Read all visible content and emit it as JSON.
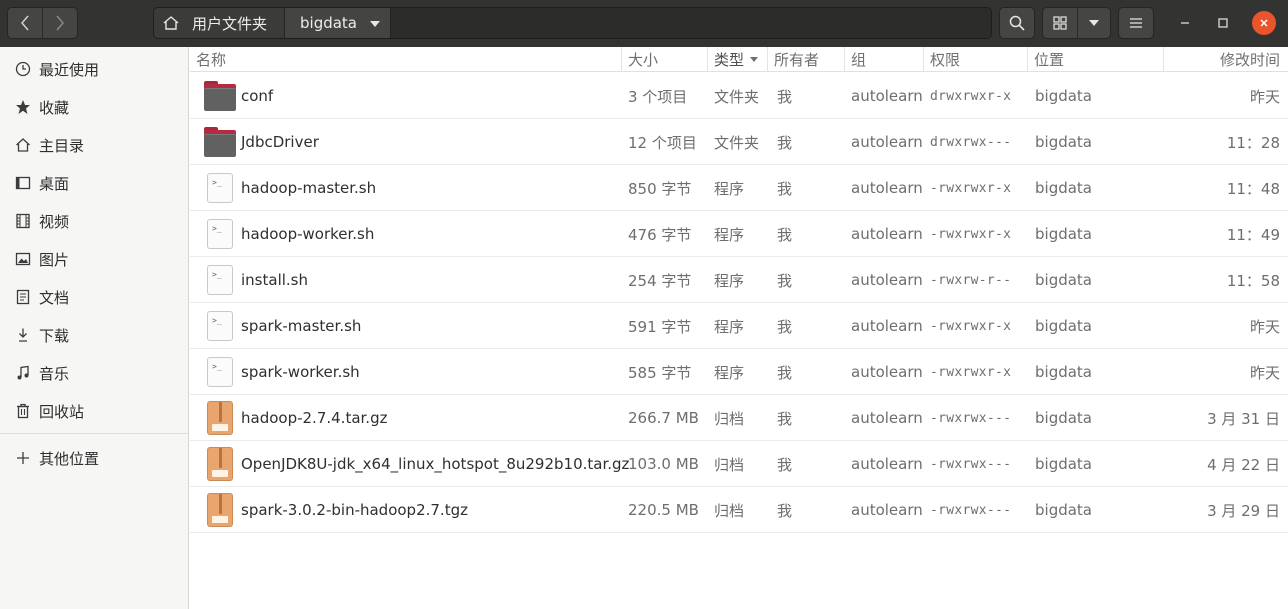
{
  "header": {
    "breadcrumbs": [
      "用户文件夹",
      "bigdata"
    ]
  },
  "sidebar": {
    "items": [
      {
        "label": "最近使用",
        "icon": "clock-icon"
      },
      {
        "label": "收藏",
        "icon": "star-icon"
      },
      {
        "label": "主目录",
        "icon": "home-icon"
      },
      {
        "label": "桌面",
        "icon": "desktop-icon"
      },
      {
        "label": "视频",
        "icon": "film-icon"
      },
      {
        "label": "图片",
        "icon": "image-icon"
      },
      {
        "label": "文档",
        "icon": "document-icon"
      },
      {
        "label": "下载",
        "icon": "download-icon"
      },
      {
        "label": "音乐",
        "icon": "music-icon"
      },
      {
        "label": "回收站",
        "icon": "trash-icon"
      }
    ],
    "other": {
      "label": "其他位置",
      "icon": "plus-icon"
    }
  },
  "columns": {
    "name": "名称",
    "size": "大小",
    "type": "类型",
    "owner": "所有者",
    "group": "组",
    "perm": "权限",
    "location": "位置",
    "modified": "修改时间"
  },
  "files": [
    {
      "icon": "folder",
      "name": "conf",
      "size": "3 个项目",
      "type": "文件夹",
      "owner": "我",
      "group": "autolearn",
      "perm": "drwxrwxr-x",
      "location": "bigdata",
      "modified": "昨天"
    },
    {
      "icon": "folder",
      "name": "JdbcDriver",
      "size": "12 个项目",
      "type": "文件夹",
      "owner": "我",
      "group": "autolearn",
      "perm": "drwxrwx---",
      "location": "bigdata",
      "modified": "11：28"
    },
    {
      "icon": "script",
      "name": "hadoop-master.sh",
      "size": "850 字节",
      "type": "程序",
      "owner": "我",
      "group": "autolearn",
      "perm": "-rwxrwxr-x",
      "location": "bigdata",
      "modified": "11：48"
    },
    {
      "icon": "script",
      "name": "hadoop-worker.sh",
      "size": "476 字节",
      "type": "程序",
      "owner": "我",
      "group": "autolearn",
      "perm": "-rwxrwxr-x",
      "location": "bigdata",
      "modified": "11：49"
    },
    {
      "icon": "script",
      "name": "install.sh",
      "size": "254 字节",
      "type": "程序",
      "owner": "我",
      "group": "autolearn",
      "perm": "-rwxrw-r--",
      "location": "bigdata",
      "modified": "11：58"
    },
    {
      "icon": "script",
      "name": "spark-master.sh",
      "size": "591 字节",
      "type": "程序",
      "owner": "我",
      "group": "autolearn",
      "perm": "-rwxrwxr-x",
      "location": "bigdata",
      "modified": "昨天"
    },
    {
      "icon": "script",
      "name": "spark-worker.sh",
      "size": "585 字节",
      "type": "程序",
      "owner": "我",
      "group": "autolearn",
      "perm": "-rwxrwxr-x",
      "location": "bigdata",
      "modified": "昨天"
    },
    {
      "icon": "archive",
      "name": "hadoop-2.7.4.tar.gz",
      "size": "266.7 MB",
      "type": "归档",
      "owner": "我",
      "group": "autolearn",
      "perm": "-rwxrwx---",
      "location": "bigdata",
      "modified": "3 月 31 日"
    },
    {
      "icon": "archive",
      "name": "OpenJDK8U-jdk_x64_linux_hotspot_8u292b10.tar.gz",
      "size": "103.0 MB",
      "type": "归档",
      "owner": "我",
      "group": "autolearn",
      "perm": "-rwxrwx---",
      "location": "bigdata",
      "modified": "4 月 22 日"
    },
    {
      "icon": "archive",
      "name": "spark-3.0.2-bin-hadoop2.7.tgz",
      "size": "220.5 MB",
      "type": "归档",
      "owner": "我",
      "group": "autolearn",
      "perm": "-rwxrwx---",
      "location": "bigdata",
      "modified": "3 月 29 日"
    }
  ]
}
